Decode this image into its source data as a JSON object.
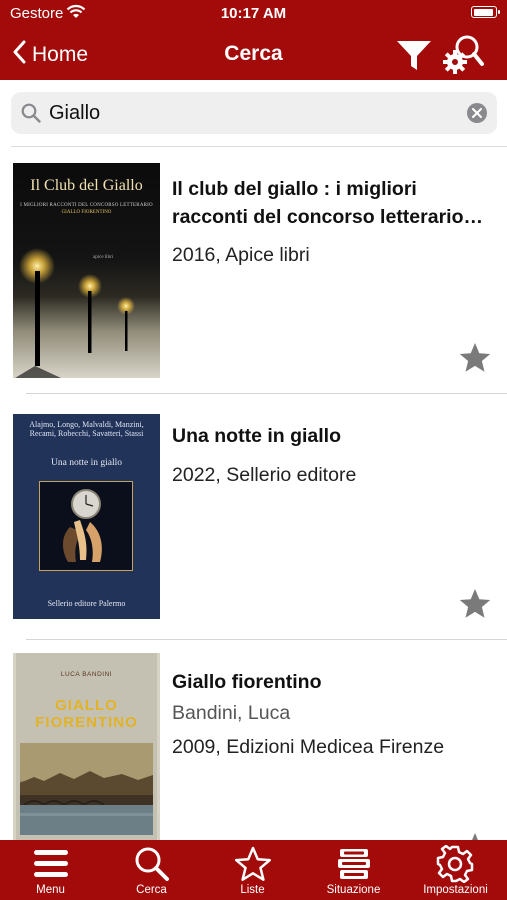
{
  "status": {
    "carrier": "Gestore",
    "time": "10:17 AM"
  },
  "nav": {
    "back_label": "Home",
    "title": "Cerca"
  },
  "search": {
    "value": "Giallo"
  },
  "results": [
    {
      "title": "Il club del giallo : i migliori racconti del concorso letterario…",
      "info": "2016, Apice libri",
      "cover": {
        "title": "Il Club del Giallo",
        "subtitle": "I MIGLIORI RACCONTI DEL CONCORSO LETTERARIO",
        "author": "GIALLO FIORENTINO",
        "publisher": "apice libri"
      }
    },
    {
      "title": "Una notte in giallo",
      "info": "2022, Sellerio editore",
      "cover": {
        "authors": "Alajmo, Longo, Malvaldi, Manzini, Recami, Robecchi, Savatteri, Stassi",
        "title": "Una notte in giallo",
        "publisher": "Sellerio editore Palermo"
      }
    },
    {
      "title": "Giallo fiorentino",
      "author": "Bandini, Luca",
      "info": "2009, Edizioni Medicea Firenze",
      "cover": {
        "author": "LUCA BANDINI",
        "title_line1": "GIALLO",
        "title_line2": "FIORENTINO"
      }
    }
  ],
  "tabs": [
    {
      "label": "Menu",
      "icon": "menu-icon"
    },
    {
      "label": "Cerca",
      "icon": "search-icon"
    },
    {
      "label": "Liste",
      "icon": "star-icon"
    },
    {
      "label": "Situazione",
      "icon": "books-icon"
    },
    {
      "label": "Impostazioni",
      "icon": "gear-icon"
    }
  ],
  "colors": {
    "brand": "#a30b0b",
    "star": "#7a7a7a"
  }
}
